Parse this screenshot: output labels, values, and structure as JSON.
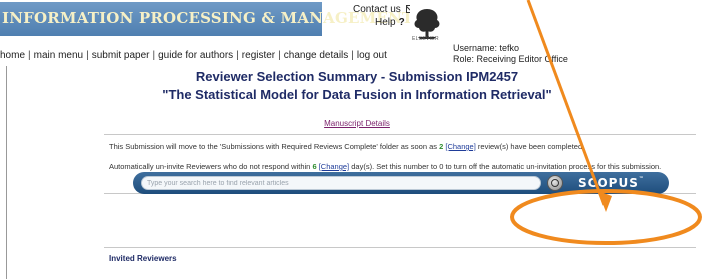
{
  "header": {
    "banner_title": "INFORMATION PROCESSING & MANAGEMENT",
    "contact_label": "Contact us",
    "help_label": "Help",
    "help_q": "?",
    "publisher_text": "ELSEVIER"
  },
  "nav": {
    "items": [
      "home",
      "main menu",
      "submit paper",
      "guide for authors",
      "register",
      "change details",
      "log out"
    ],
    "separator": "|"
  },
  "user": {
    "username_line": "Username: tefko",
    "role_line": "Role: Receiving Editor Office"
  },
  "main": {
    "title": "Reviewer Selection Summary - Submission IPM2457",
    "subtitle": "\"The Statistical Model for Data Fusion in Information Retrieval\"",
    "manuscript_link": "Manuscript Details",
    "para1_a": "This Submission will move to the 'Submissions with Required Reviews Complete' folder as soon as ",
    "para1_num": "2",
    "para1_change": "[Change]",
    "para1_b": " review(s) have been completed.",
    "para2_a": "Automatically un-invite Reviewers who do not respond within ",
    "para2_num": "6",
    "para2_change": "[Change]",
    "para2_b": " day(s). Set this number to 0 to turn off the automatic un-invitation process for this submission.",
    "invited_heading": "Invited Reviewers"
  },
  "search": {
    "placeholder": "Type your search here to find relevant articles",
    "brand": "SCOPUS",
    "brand_mark": "™"
  },
  "colors": {
    "banner": "#5a8abb",
    "banner_text": "#f6f0c6",
    "title": "#1f2b66",
    "annotation": "#f08a1e",
    "search_bar": "#1e4d7c"
  },
  "icons": {
    "mail": "envelope-icon",
    "search": "magnifier-icon",
    "logo": "elsevier-tree-logo"
  }
}
